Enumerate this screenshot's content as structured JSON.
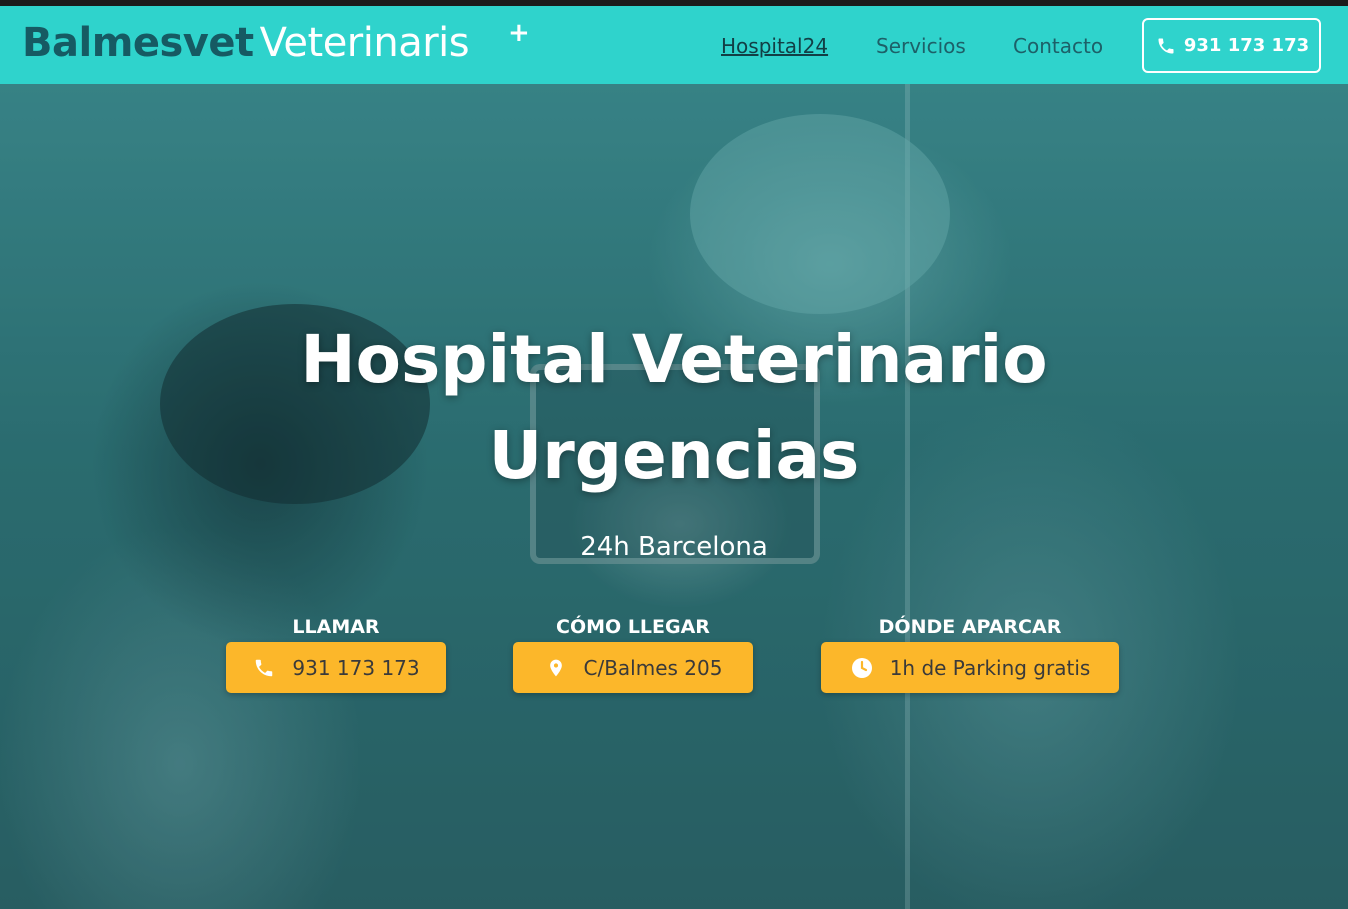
{
  "header": {
    "logo_bold": "Balmesvet",
    "logo_light": "Veterinaris",
    "logo_plus": "+",
    "nav": [
      {
        "label": "Hospital24",
        "active": true
      },
      {
        "label": "Servicios",
        "active": false
      },
      {
        "label": "Contacto",
        "active": false
      }
    ],
    "phone": "931 173 173",
    "phone_icon": "phone-icon"
  },
  "hero": {
    "title_line1": "Hospital Veterinario",
    "title_line2": "Urgencias",
    "subtitle": "24h Barcelona",
    "ctas": [
      {
        "label": "LLAMAR",
        "button": "931 173 173",
        "icon": "phone-icon"
      },
      {
        "label": "CÓMO LLEGAR",
        "button": "C/Balmes 205",
        "icon": "map-pin-icon"
      },
      {
        "label": "DÓNDE APARCAR",
        "button": "1h de Parking gratis",
        "icon": "clock-icon"
      }
    ]
  },
  "colors": {
    "navbar": "#2fd3cc",
    "logo_dark": "#165a63",
    "cta": "#fcb72a",
    "hero_tint": "#2f7477"
  }
}
